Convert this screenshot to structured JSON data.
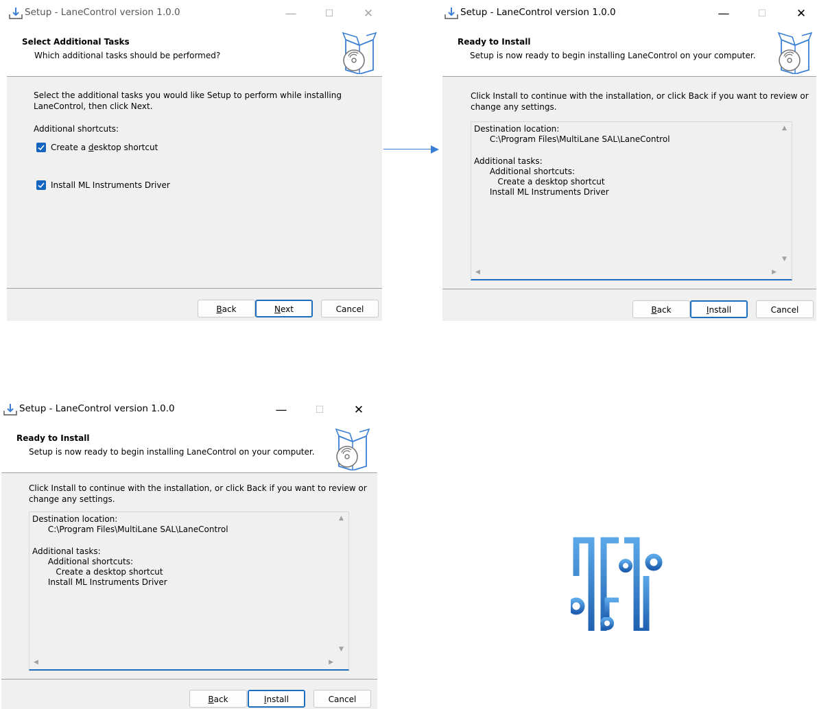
{
  "title": "Setup - LaneControl version 1.0.0",
  "tasks_page": {
    "heading": "Select Additional Tasks",
    "subheading": "Which additional tasks should be performed?",
    "intro_line1": "Select the additional tasks you would like Setup to perform while installing",
    "intro_line2": "LaneControl, then click Next.",
    "group_label": "Additional shortcuts:",
    "checkboxes": [
      {
        "label_pre": "Create a ",
        "label_ul": "d",
        "label_post": "esktop shortcut",
        "checked": true
      },
      {
        "label": "Install ML Instruments Driver",
        "checked": true
      }
    ]
  },
  "ready_page": {
    "heading": "Ready to Install",
    "subheading": "Setup is now ready to begin installing LaneControl on your computer.",
    "intro_line1": "Click Install to continue with the installation, or click Back if you want to review or",
    "intro_line2": "change any settings.",
    "summary_lines": [
      "Destination location:",
      "      C:\\Program Files\\MultiLane SAL\\LaneControl",
      "",
      "Additional tasks:",
      "      Additional shortcuts:",
      "         Create a desktop shortcut",
      "      Install ML Instruments Driver"
    ]
  },
  "buttons": {
    "back_ul": "B",
    "back_rest": "ack",
    "next_ul": "N",
    "next_rest": "ext",
    "install_ul": "I",
    "install_rest": "nstall",
    "cancel": "Cancel"
  },
  "window_controls": {
    "minimize": "—",
    "maximize": "☐",
    "close": "✕"
  },
  "colors": {
    "accent": "#1a6cc0",
    "checkbox": "#1565c0",
    "logo": "#2f7fd0",
    "arrow": "#3a7fd5"
  }
}
